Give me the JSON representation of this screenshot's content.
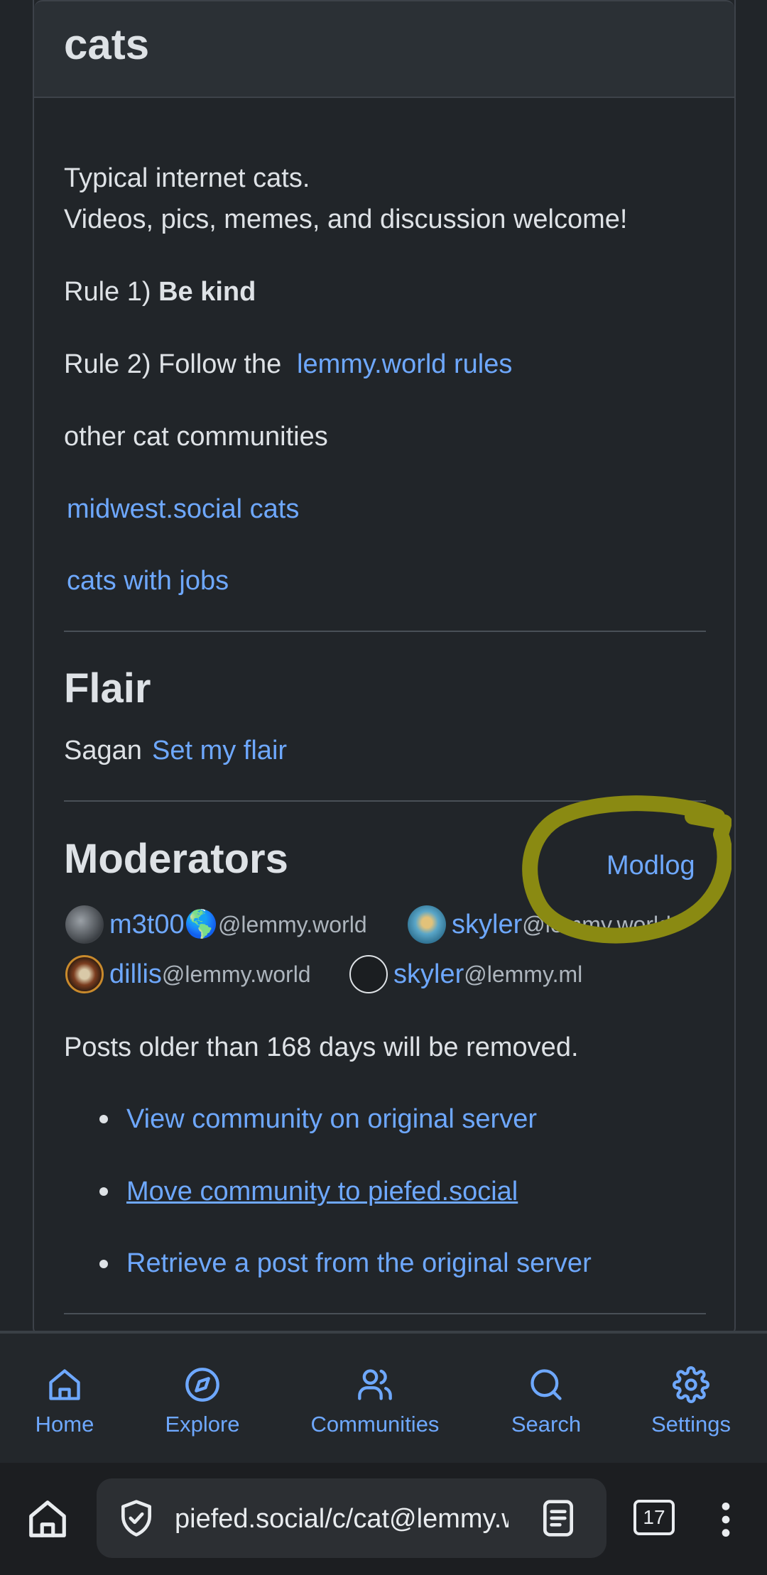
{
  "community": {
    "title": "cats",
    "description_line1": "Typical internet cats.",
    "description_line2": "Videos, pics, memes, and discussion welcome!",
    "rule1_prefix": "Rule 1)",
    "rule1_bold": "Be kind",
    "rule2_prefix": "Rule 2) Follow the",
    "rule2_link": "lemmy.world rules",
    "other_heading": "other cat communities",
    "other_links": [
      "midwest.social cats",
      "cats with jobs"
    ]
  },
  "flair": {
    "heading": "Flair",
    "value": "Sagan",
    "set_link": "Set my flair"
  },
  "moderators": {
    "heading": "Moderators",
    "modlog": "Modlog",
    "list": [
      {
        "name": "m3t00🌎",
        "instance": "@lemmy.world"
      },
      {
        "name": "skyler",
        "instance": "@lemmy.world"
      },
      {
        "name": "dillis",
        "instance": "@lemmy.world"
      },
      {
        "name": "skyler",
        "instance": "@lemmy.ml"
      }
    ]
  },
  "notice": "Posts older than 168 days will be removed.",
  "actions": [
    "View community on original server",
    "Move community to piefed.social",
    "Retrieve a post from the original server"
  ],
  "nav": [
    {
      "label": "Home",
      "icon": "home-icon"
    },
    {
      "label": "Explore",
      "icon": "compass-icon"
    },
    {
      "label": "Communities",
      "icon": "users-icon"
    },
    {
      "label": "Search",
      "icon": "search-icon"
    },
    {
      "label": "Settings",
      "icon": "gear-icon"
    }
  ],
  "browser": {
    "url": "piefed.social/c/cat@lemmy.world",
    "tab_count": "17"
  },
  "colors": {
    "background": "#212529",
    "link": "#6ea8fe",
    "annotation": "#8a8a12"
  }
}
